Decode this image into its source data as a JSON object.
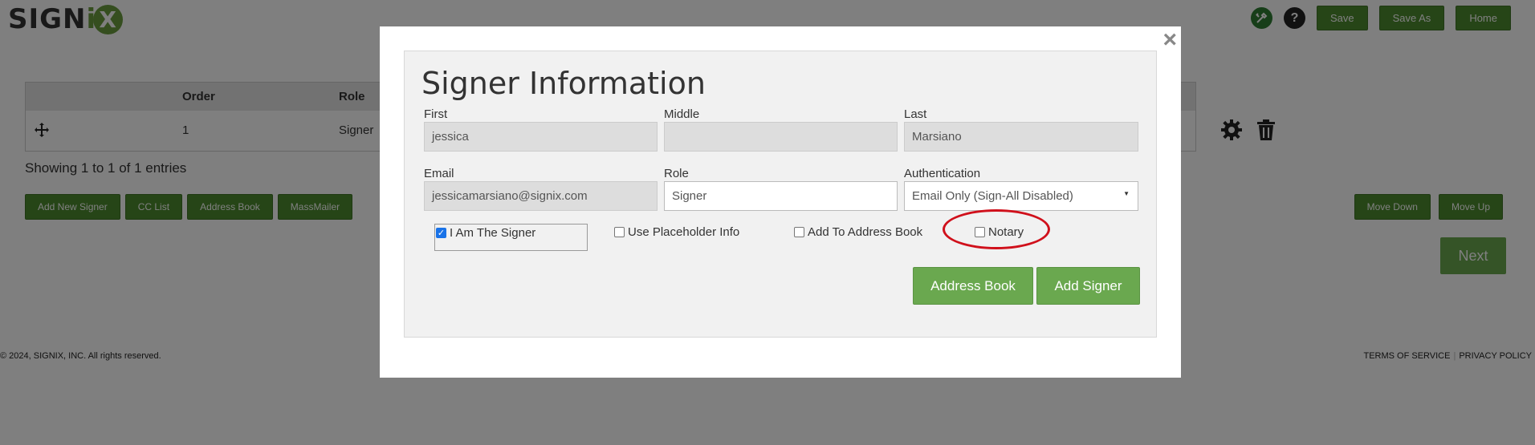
{
  "brand": {
    "logo_text_a": "SIGN",
    "logo_text_i": "i",
    "logo_text_x": "X"
  },
  "header": {
    "tools_icon": "tools-icon",
    "help_icon": "help-icon",
    "help_glyph": "?",
    "save_label": "Save",
    "save_as_label": "Save As",
    "home_label": "Home"
  },
  "table": {
    "columns": [
      "Order",
      "Role"
    ],
    "rows": [
      {
        "order": "1",
        "role": "Signer"
      }
    ]
  },
  "entries_text": "Showing 1 to 1 of 1 entries",
  "actions": {
    "add_new_signer": "Add New Signer",
    "cc_list": "CC List",
    "address_book": "Address Book",
    "mass_mailer": "MassMailer",
    "move_down": "Move Down",
    "move_up": "Move Up",
    "next": "Next"
  },
  "footer": {
    "copyright": "© 2024, SIGNIX, INC. All rights reserved.",
    "terms": "TERMS OF SERVICE",
    "separator": "|",
    "privacy": "PRIVACY POLICY"
  },
  "modal": {
    "close_glyph": "×",
    "title": "Signer Information",
    "first_label": "First",
    "first_value": "jessica",
    "middle_label": "Middle",
    "middle_value": "",
    "last_label": "Last",
    "last_value": "Marsiano",
    "email_label": "Email",
    "email_value": "jessicamarsiano@signix.com",
    "role_label": "Role",
    "role_value": "Signer",
    "auth_label": "Authentication",
    "auth_value": "Email Only (Sign-All Disabled)",
    "checkboxes": {
      "i_am_signer": {
        "label": "I Am The Signer",
        "checked": true
      },
      "use_placeholder": {
        "label": "Use Placeholder Info",
        "checked": false
      },
      "add_to_address_book": {
        "label": "Add To Address Book",
        "checked": false
      },
      "notary": {
        "label": "Notary",
        "checked": false
      }
    },
    "address_book_button": "Address Book",
    "add_signer_button": "Add Signer"
  },
  "colors": {
    "brand_green": "#6aa84f",
    "dark_green": "#4c8a2e",
    "highlight_red": "#d0101b",
    "checkbox_blue": "#1a73e8"
  }
}
